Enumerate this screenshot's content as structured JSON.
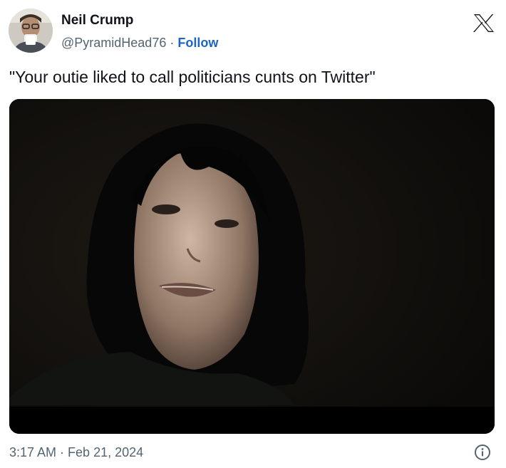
{
  "author": {
    "display_name": "Neil Crump",
    "handle": "@PyramidHead76",
    "separator": " · ",
    "follow_label": "Follow"
  },
  "tweet": {
    "text": "\"Your outie liked to call politicians cunts on Twitter\"",
    "time": "3:17 AM",
    "date_separator": " · ",
    "date": "Feb 21, 2024"
  },
  "icons": {
    "brand": "x-logo-icon",
    "info": "info-icon"
  },
  "colors": {
    "text": "#0f1419",
    "secondary": "#536471",
    "follow": "#1d65c1",
    "media_background": "#000000"
  }
}
